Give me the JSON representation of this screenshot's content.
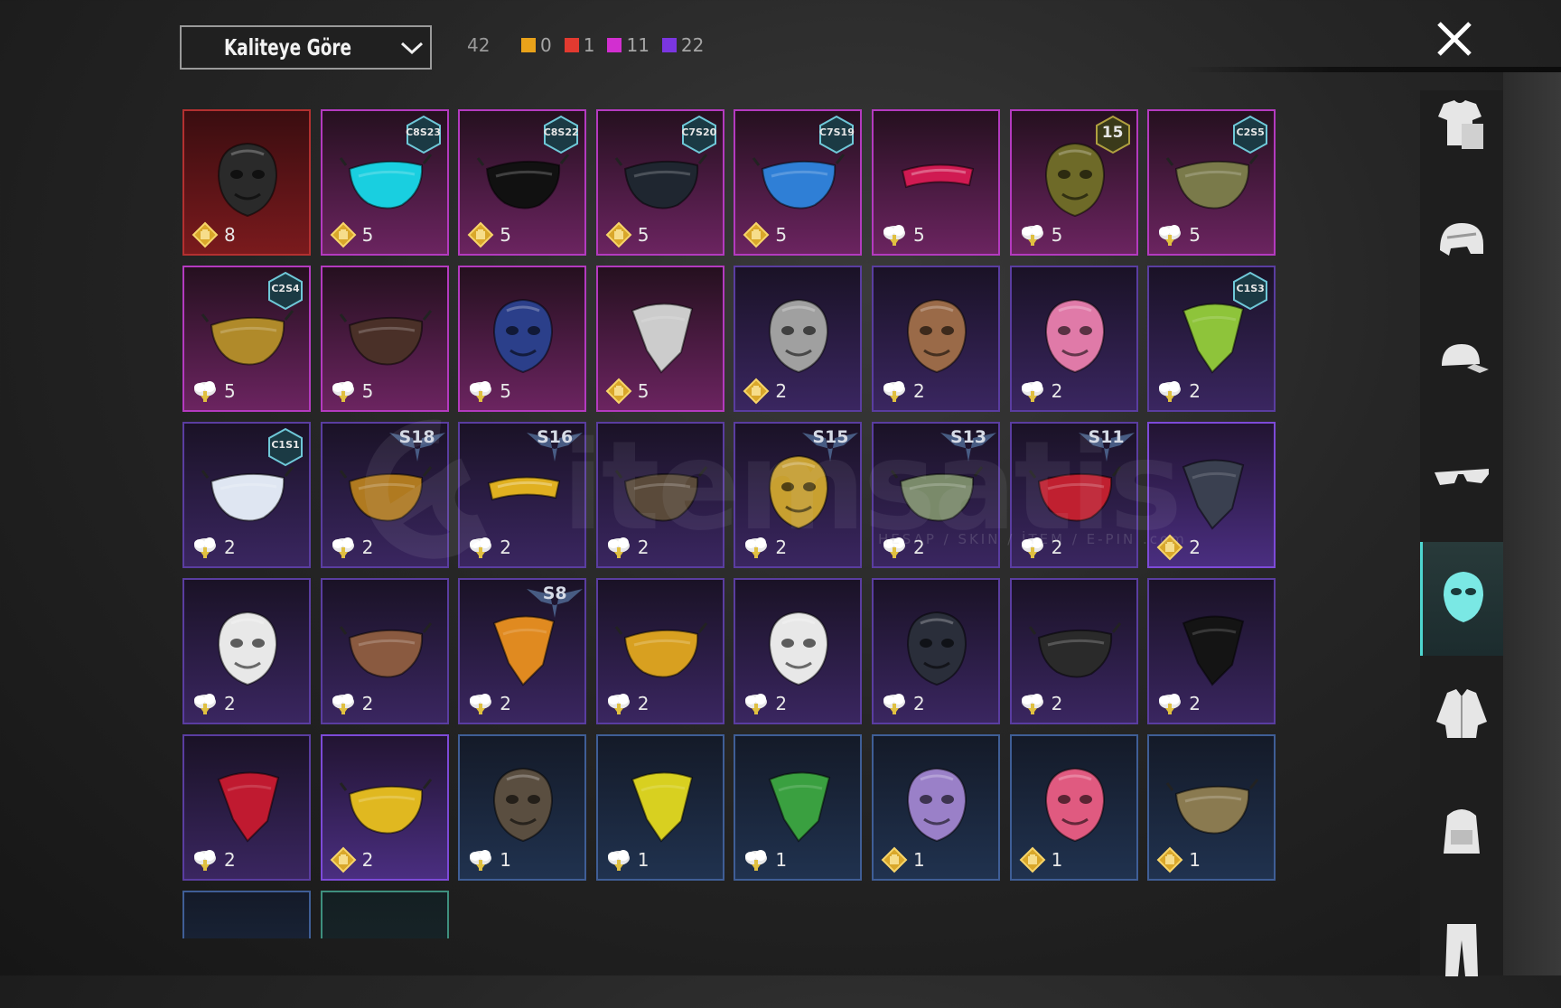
{
  "header": {
    "sort_label": "Kaliteye Göre",
    "total_count": "42",
    "quality_counts": [
      {
        "color": "#e9a21a",
        "count": "0"
      },
      {
        "color": "#e23a30",
        "count": "1"
      },
      {
        "color": "#d22fd0",
        "count": "11"
      },
      {
        "color": "#7b36e0",
        "count": "22"
      }
    ]
  },
  "watermark": {
    "text": "itemsatis",
    "sub": "HESAP / SKIN / İTEM / E-PIN .com"
  },
  "cards": [
    {
      "r": 0,
      "c": 0,
      "frame": "red",
      "qty": "8",
      "coin": "gold",
      "icon": "helmet-mask-icon",
      "tint": "#2a2a2a"
    },
    {
      "r": 0,
      "c": 1,
      "frame": "pink",
      "qty": "5",
      "coin": "gold",
      "icon": "neon-mask-icon",
      "tint": "#19cfe0",
      "badge": "C8S23"
    },
    {
      "r": 0,
      "c": 2,
      "frame": "pink",
      "qty": "5",
      "coin": "gold",
      "icon": "black-mask-icon",
      "tint": "#111",
      "badge": "C8S22"
    },
    {
      "r": 0,
      "c": 3,
      "frame": "pink",
      "qty": "5",
      "coin": "gold",
      "icon": "half-mask-icon",
      "tint": "#1f2630",
      "badge": "C7S20"
    },
    {
      "r": 0,
      "c": 4,
      "frame": "pink",
      "qty": "5",
      "coin": "gold",
      "icon": "robot-mask-icon",
      "tint": "#2f7fd6",
      "badge": "C7S19"
    },
    {
      "r": 0,
      "c": 5,
      "frame": "pink",
      "qty": "5",
      "coin": "silver",
      "icon": "visor-icon",
      "tint": "#d01a52"
    },
    {
      "r": 0,
      "c": 6,
      "frame": "pink",
      "qty": "5",
      "coin": "silver",
      "icon": "cat-mask-icon",
      "tint": "#6e6a28",
      "badge": "15"
    },
    {
      "r": 0,
      "c": 7,
      "frame": "pink",
      "qty": "5",
      "coin": "silver",
      "icon": "cloth-mask-icon",
      "tint": "#7a7a4a",
      "badge": "C2S5"
    },
    {
      "r": 1,
      "c": 0,
      "frame": "pink",
      "qty": "5",
      "coin": "silver",
      "icon": "gas-mask-icon",
      "tint": "#b08a2a",
      "badge": "C2S4"
    },
    {
      "r": 1,
      "c": 1,
      "frame": "pink",
      "qty": "5",
      "coin": "silver",
      "icon": "plague-mask-icon",
      "tint": "#4a3028"
    },
    {
      "r": 1,
      "c": 2,
      "frame": "pink",
      "qty": "5",
      "coin": "silver",
      "icon": "galaxy-mask-icon",
      "tint": "#2b3f8a"
    },
    {
      "r": 1,
      "c": 3,
      "frame": "pink",
      "qty": "5",
      "coin": "gold",
      "icon": "skull-bandana-icon",
      "tint": "#cccccc"
    },
    {
      "r": 1,
      "c": 4,
      "frame": "purple",
      "qty": "2",
      "coin": "gold",
      "icon": "hockey-mask-icon",
      "tint": "#a0a0a0"
    },
    {
      "r": 1,
      "c": 5,
      "frame": "purple",
      "qty": "2",
      "coin": "silver",
      "icon": "mammoth-mask-icon",
      "tint": "#9a6a48"
    },
    {
      "r": 1,
      "c": 6,
      "frame": "purple",
      "qty": "2",
      "coin": "silver",
      "icon": "dino-mask-icon",
      "tint": "#e07aa8"
    },
    {
      "r": 1,
      "c": 7,
      "frame": "purple",
      "qty": "2",
      "coin": "silver",
      "icon": "cactus-bandana-icon",
      "tint": "#8ec43a",
      "badge": "C1S3"
    },
    {
      "r": 2,
      "c": 0,
      "frame": "purple",
      "qty": "2",
      "coin": "silver",
      "icon": "shark-mask-icon",
      "tint": "#dfe6f2",
      "badge": "C1S1"
    },
    {
      "r": 2,
      "c": 1,
      "frame": "purple",
      "qty": "2",
      "coin": "silver",
      "icon": "flame-mask-icon",
      "tint": "#b07a20",
      "sbadge": "S18"
    },
    {
      "r": 2,
      "c": 2,
      "frame": "purple",
      "qty": "2",
      "coin": "silver",
      "icon": "gold-visor-icon",
      "tint": "#e0b020",
      "sbadge": "S16"
    },
    {
      "r": 2,
      "c": 3,
      "frame": "purple",
      "qty": "2",
      "coin": "silver",
      "icon": "ninja-mask-icon",
      "tint": "#5a4a3a"
    },
    {
      "r": 2,
      "c": 4,
      "frame": "purple",
      "qty": "2",
      "coin": "silver",
      "icon": "demon-mask-icon",
      "tint": "#c8a030",
      "sbadge": "S15"
    },
    {
      "r": 2,
      "c": 5,
      "frame": "purple",
      "qty": "2",
      "coin": "silver",
      "icon": "goggles-mask-icon",
      "tint": "#7a8a6a",
      "sbadge": "S13"
    },
    {
      "r": 2,
      "c": 6,
      "frame": "purple",
      "qty": "2",
      "coin": "silver",
      "icon": "red-half-mask-icon",
      "tint": "#c02030",
      "sbadge": "S11"
    },
    {
      "r": 2,
      "c": 7,
      "frame": "purple-hl",
      "qty": "2",
      "coin": "gold",
      "icon": "dark-bandana-icon",
      "tint": "#3a4050"
    },
    {
      "r": 3,
      "c": 0,
      "frame": "purple",
      "qty": "2",
      "coin": "silver",
      "icon": "clown-mask-icon",
      "tint": "#e8e8e8"
    },
    {
      "r": 3,
      "c": 1,
      "frame": "purple",
      "qty": "2",
      "coin": "silver",
      "icon": "leather-mask-icon",
      "tint": "#8a5a40"
    },
    {
      "r": 3,
      "c": 2,
      "frame": "purple",
      "qty": "2",
      "coin": "silver",
      "icon": "fire-bandana-icon",
      "tint": "#e08a20",
      "sbadge": "S8"
    },
    {
      "r": 3,
      "c": 3,
      "frame": "purple",
      "qty": "2",
      "coin": "silver",
      "icon": "studded-mask-icon",
      "tint": "#d8a020"
    },
    {
      "r": 3,
      "c": 4,
      "frame": "purple",
      "qty": "2",
      "coin": "silver",
      "icon": "skull-face-mask-icon",
      "tint": "#e8e8e8"
    },
    {
      "r": 3,
      "c": 5,
      "frame": "purple",
      "qty": "2",
      "coin": "silver",
      "icon": "dark-helmet-icon",
      "tint": "#2a2e3a"
    },
    {
      "r": 3,
      "c": 6,
      "frame": "purple",
      "qty": "2",
      "coin": "silver",
      "icon": "tactical-mask-icon",
      "tint": "#2a2a2a"
    },
    {
      "r": 3,
      "c": 7,
      "frame": "purple",
      "qty": "2",
      "coin": "silver",
      "icon": "black-bandana-icon",
      "tint": "#141414"
    },
    {
      "r": 4,
      "c": 0,
      "frame": "purple",
      "qty": "2",
      "coin": "silver",
      "icon": "red-scarf-icon",
      "tint": "#c01a30"
    },
    {
      "r": 4,
      "c": 1,
      "frame": "purple-hl",
      "qty": "2",
      "coin": "gold",
      "icon": "gold-mask-icon",
      "tint": "#e0b820"
    },
    {
      "r": 4,
      "c": 2,
      "frame": "blue",
      "qty": "1",
      "coin": "silver",
      "icon": "rusty-mask-icon",
      "tint": "#5a4e40"
    },
    {
      "r": 4,
      "c": 3,
      "frame": "blue",
      "qty": "1",
      "coin": "silver",
      "icon": "dotted-bandana-icon",
      "tint": "#d8d020"
    },
    {
      "r": 4,
      "c": 4,
      "frame": "blue",
      "qty": "1",
      "coin": "silver",
      "icon": "web-bandana-icon",
      "tint": "#3aa040"
    },
    {
      "r": 4,
      "c": 5,
      "frame": "blue",
      "qty": "1",
      "coin": "gold",
      "icon": "purple-face-mask-icon",
      "tint": "#9a80c8"
    },
    {
      "r": 4,
      "c": 6,
      "frame": "blue",
      "qty": "1",
      "coin": "gold",
      "icon": "pink-face-mask-icon",
      "tint": "#e05a80"
    },
    {
      "r": 4,
      "c": 7,
      "frame": "blue",
      "qty": "1",
      "coin": "gold",
      "icon": "camo-mask-icon",
      "tint": "#8a7a50"
    },
    {
      "r": 5,
      "c": 0,
      "frame": "blue",
      "qty": "",
      "coin": "none",
      "icon": "partial-item-icon",
      "tint": "#333"
    },
    {
      "r": 5,
      "c": 1,
      "frame": "green",
      "qty": "",
      "coin": "none",
      "icon": "partial-item-icon",
      "tint": "#555"
    }
  ],
  "sidebar": [
    {
      "name": "outfit-tab",
      "icon": "outfit-icon",
      "active": false
    },
    {
      "name": "helmet-tab",
      "icon": "helmet-icon",
      "active": false
    },
    {
      "name": "hat-tab",
      "icon": "cap-icon",
      "active": false
    },
    {
      "name": "glasses-tab",
      "icon": "glasses-icon",
      "active": false
    },
    {
      "name": "mask-tab",
      "icon": "mask-icon",
      "active": true
    },
    {
      "name": "jacket-tab",
      "icon": "jacket-icon",
      "active": false
    },
    {
      "name": "backpack-tab",
      "icon": "backpack-icon",
      "active": false
    },
    {
      "name": "pants-tab",
      "icon": "pants-icon",
      "active": false
    }
  ]
}
